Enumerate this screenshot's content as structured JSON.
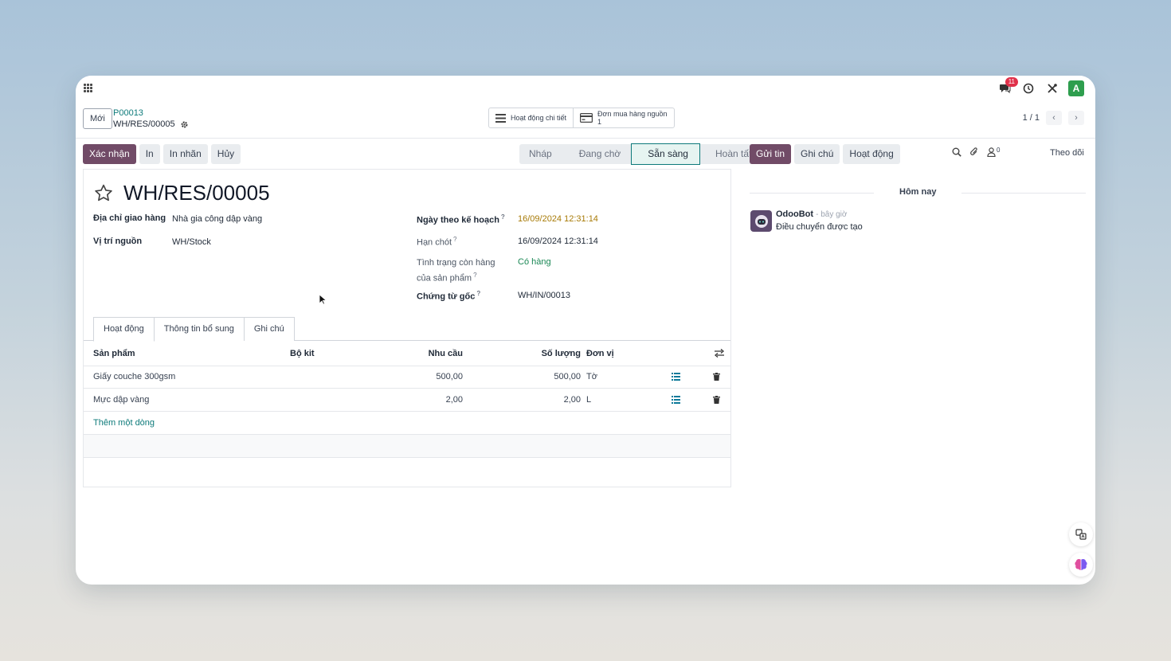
{
  "header": {
    "messages_badge": "11",
    "user_initial": "A"
  },
  "control_panel": {
    "new_button": "Mới",
    "breadcrumb_parent": "P00013",
    "breadcrumb_current": "WH/RES/00005",
    "smart_buttons": {
      "detailed_operations": "Hoạt động chi tiết",
      "source_po_label": "Đơn mua hàng nguồn",
      "source_po_count": "1"
    },
    "pager": "1 / 1"
  },
  "actions": {
    "confirm": "Xác nhận",
    "print": "In",
    "print_labels": "In nhãn",
    "cancel": "Hủy"
  },
  "status_stages": {
    "draft": "Nháp",
    "waiting": "Đang chờ",
    "ready": "Sẵn sàng",
    "done": "Hoàn tất",
    "active": "Sẵn sàng"
  },
  "form": {
    "title": "WH/RES/00005",
    "delivery_address_label": "Địa chỉ giao hàng",
    "delivery_address_value": "Nhà gia công dập vàng",
    "source_location_label": "Vị trí nguồn",
    "source_location_value": "WH/Stock",
    "scheduled_date_label": "Ngày theo kế hoạch",
    "scheduled_date_value": "16/09/2024 12:31:14",
    "deadline_label": "Hạn chót",
    "deadline_value": "16/09/2024 12:31:14",
    "availability_label_line1": "Tình trạng còn hàng",
    "availability_label_line2": "của sản phẩm",
    "availability_value": "Có hàng",
    "source_doc_label": "Chứng từ gốc",
    "source_doc_value": "WH/IN/00013",
    "help_mark": "?"
  },
  "tabs": {
    "operations": "Hoạt động",
    "additional_info": "Thông tin bổ sung",
    "note": "Ghi chú"
  },
  "moves_table": {
    "columns": {
      "product": "Sản phẩm",
      "kit": "Bộ kit",
      "demand": "Nhu cầu",
      "quantity": "Số lượng",
      "uom": "Đơn vị"
    },
    "rows": [
      {
        "product": "Giấy couche 300gsm",
        "demand": "500,00",
        "quantity": "500,00",
        "uom": "Tờ"
      },
      {
        "product": "Mực dập vàng",
        "demand": "2,00",
        "quantity": "2,00",
        "uom": "L"
      }
    ],
    "add_line": "Thêm một dòng"
  },
  "chatter": {
    "send_message": "Gửi tin",
    "log_note": "Ghi chú",
    "activities": "Hoạt động",
    "followers_count": "0",
    "follow": "Theo dõi",
    "date_divider": "Hôm nay",
    "messages": [
      {
        "author": "OdooBot",
        "time": "- bây giờ",
        "body": "Điều chuyển được tạo"
      }
    ]
  },
  "colors": {
    "primary": "#714b67",
    "accent_teal": "#0d7a7a",
    "success": "#198754",
    "warning": "#a77a06"
  }
}
